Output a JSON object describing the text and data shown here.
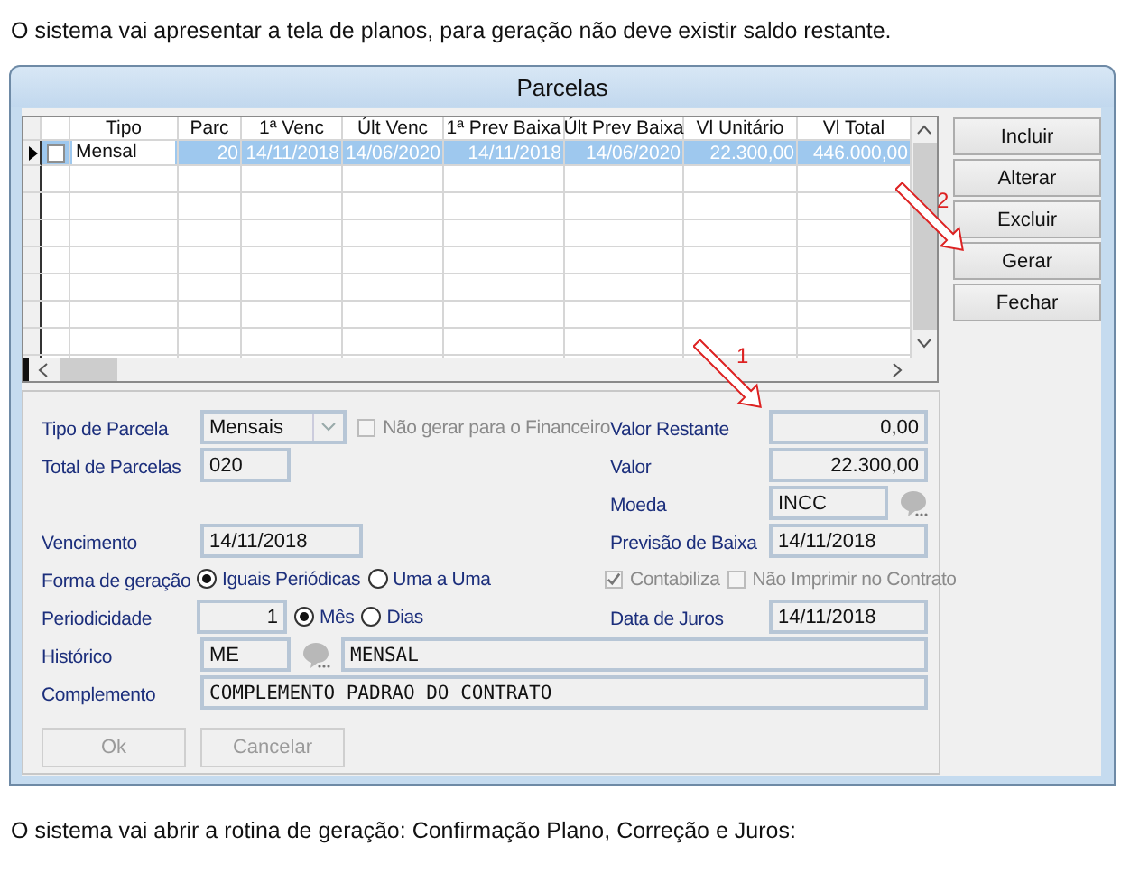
{
  "intro_text": "O sistema vai apresentar a tela de planos, para geração não deve existir saldo restante.",
  "window": {
    "title": "Parcelas"
  },
  "grid": {
    "columns": [
      "Tipo",
      "Parc",
      "1ª Venc",
      "Últ Venc",
      "1ª Prev Baixa",
      "Últ Prev Baixa",
      "Vl Unitário",
      "Vl Total"
    ],
    "rows": [
      {
        "current": true,
        "selected": true,
        "checked": false,
        "editing": true,
        "cells": [
          "Mensal",
          "20",
          "14/11/2018",
          "14/06/2020",
          "14/11/2018",
          "14/06/2020",
          "22.300,00",
          "446.000,00"
        ]
      }
    ]
  },
  "side_buttons": [
    {
      "label": "Incluir"
    },
    {
      "label": "Alterar"
    },
    {
      "label": "Excluir"
    },
    {
      "label": "Gerar"
    },
    {
      "label": "Fechar"
    }
  ],
  "form": {
    "tipo_parcela": {
      "label": "Tipo de Parcela",
      "value": "Mensais"
    },
    "nao_gerar": {
      "label": "Não gerar para o Financeiro",
      "checked": false,
      "disabled": true
    },
    "total_parcelas": {
      "label": "Total de Parcelas",
      "value": "020"
    },
    "vencimento": {
      "label": "Vencimento",
      "value": "14/11/2018"
    },
    "forma_geracao": {
      "label": "Forma de geração",
      "options": [
        {
          "label": "Iguais Periódicas",
          "selected": true
        },
        {
          "label": "Uma a Uma",
          "selected": false
        }
      ]
    },
    "periodicidade": {
      "label": "Periodicidade",
      "value": "1",
      "options": [
        {
          "label": "Mês",
          "selected": true
        },
        {
          "label": "Dias",
          "selected": false
        }
      ]
    },
    "historico": {
      "label": "Histórico",
      "code": "ME",
      "description": "MENSAL"
    },
    "complemento": {
      "label": "Complemento",
      "value": "COMPLEMENTO PADRAO DO CONTRATO"
    },
    "valor_restante": {
      "label": "Valor Restante",
      "value": "0,00"
    },
    "valor": {
      "label": "Valor",
      "value": "22.300,00"
    },
    "moeda": {
      "label": "Moeda",
      "value": "INCC"
    },
    "previsao_baixa": {
      "label": "Previsão de Baixa",
      "value": "14/11/2018"
    },
    "contabiliza": {
      "label": "Contabiliza",
      "checked": true,
      "disabled": true
    },
    "nao_imprimir": {
      "label": "Não Imprimir no Contrato",
      "checked": false,
      "disabled": true
    },
    "data_juros": {
      "label": "Data de Juros",
      "value": "14/11/2018"
    },
    "buttons": [
      {
        "label": "Ok",
        "disabled": true
      },
      {
        "label": "Cancelar",
        "disabled": true
      }
    ]
  },
  "annotations": [
    {
      "label": "1"
    },
    {
      "label": "2"
    }
  ],
  "outro_text": "O sistema vai abrir a rotina de geração: Confirmação Plano, Correção e Juros:"
}
